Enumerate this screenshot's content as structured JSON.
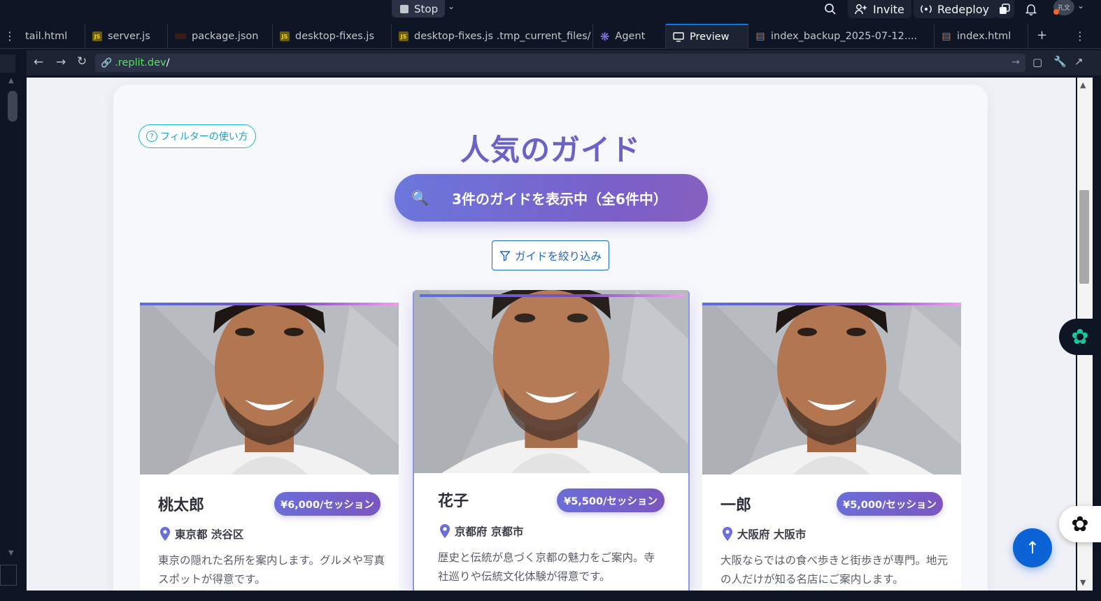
{
  "topbar": {
    "stop_label": "Stop",
    "invite_label": "Invite",
    "redeploy_label": "Redeploy",
    "avatar_text": "孔文"
  },
  "tabs": [
    {
      "label": "tail.html",
      "icon": "html-file-icon"
    },
    {
      "label": "server.js",
      "icon": "js-file-icon"
    },
    {
      "label": "package.json",
      "icon": "json-file-icon"
    },
    {
      "label": "desktop-fixes.js",
      "icon": "js-file-icon"
    },
    {
      "label": "desktop-fixes.js .tmp_current_files/",
      "icon": "js-file-icon"
    },
    {
      "label": "Agent",
      "icon": "agent-icon"
    },
    {
      "label": "Preview",
      "icon": "monitor-icon"
    },
    {
      "label": "index_backup_2025-07-12....",
      "icon": "html-file-icon"
    },
    {
      "label": "index.html",
      "icon": "html-file-icon"
    }
  ],
  "address": {
    "domain": ".replit.dev",
    "path": "/"
  },
  "page": {
    "help_label": "フィルターの使い方",
    "title": "人気のガイド",
    "count_text": "3件のガイドを表示中（全6件中）",
    "filter_label": "ガイドを絞り込み"
  },
  "guides": [
    {
      "name": "桃太郎",
      "price": "¥6,000/セッション",
      "location": "東京都 渋谷区",
      "desc_line1": "東京の隠れた名所を案内します。グルメや写真",
      "desc_line2": "スポットが得意です。"
    },
    {
      "name": "花子",
      "price": "¥5,500/セッション",
      "location": "京都府 京都市",
      "desc_line1": "歴史と伝統が息づく京都の魅力をご案内。寺",
      "desc_line2": "社巡りや伝統文化体験が得意です。"
    },
    {
      "name": "一郎",
      "price": "¥5,000/セッション",
      "location": "大阪府 大阪市",
      "desc_line1": "大阪ならではの食べ歩きと街歩きが専門。地元",
      "desc_line2": "の人だけが知る名店にご案内します。"
    }
  ],
  "colors": {
    "accent_purple": "#6a62c8",
    "filter_blue": "#1e66c8",
    "help_cyan": "#17a3c6",
    "to_top_blue": "#0b63d6"
  }
}
